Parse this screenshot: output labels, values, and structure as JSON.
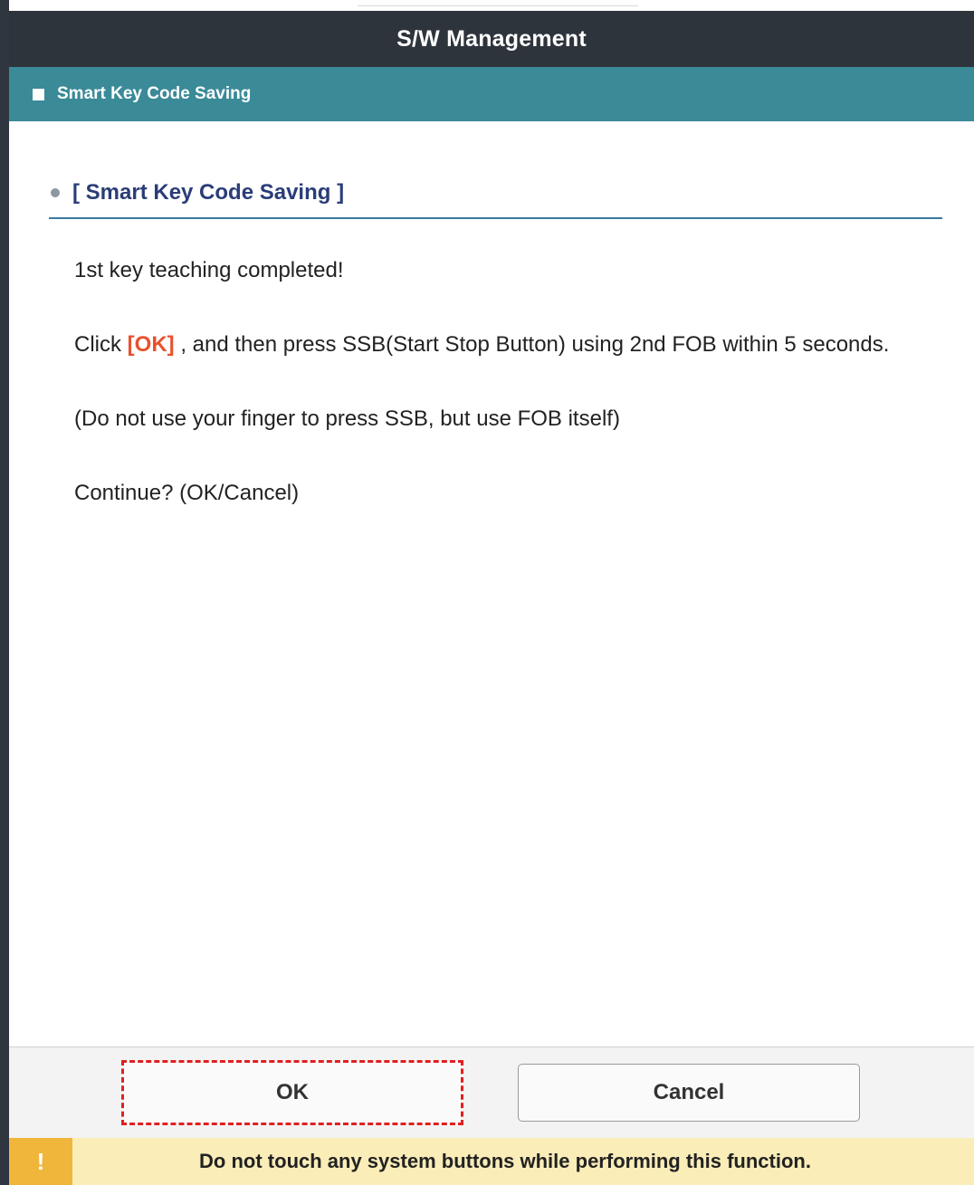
{
  "window": {
    "title": "S/W Management"
  },
  "section": {
    "label": "Smart Key Code Saving"
  },
  "content": {
    "heading": "[ Smart Key Code Saving ]",
    "line1": "1st key teaching completed!",
    "line2_prefix": "Click ",
    "line2_ok": "[OK]",
    "line2_suffix": " , and then press SSB(Start Stop Button) using 2nd FOB within 5 seconds.",
    "line3": "(Do not use your finger to press SSB, but use FOB itself)",
    "line4": "Continue? (OK/Cancel)"
  },
  "buttons": {
    "ok_label": "OK",
    "cancel_label": "Cancel"
  },
  "warning": {
    "icon": "exclamation-icon",
    "icon_glyph": "!",
    "text": "Do not touch any system buttons while performing this function."
  },
  "colors": {
    "titlebar": "#2e343c",
    "section_bar": "#3a8a98",
    "ok_highlight": "#e8512c",
    "warning_bg": "#faedb8",
    "warning_icon_bg": "#f0b63c"
  }
}
